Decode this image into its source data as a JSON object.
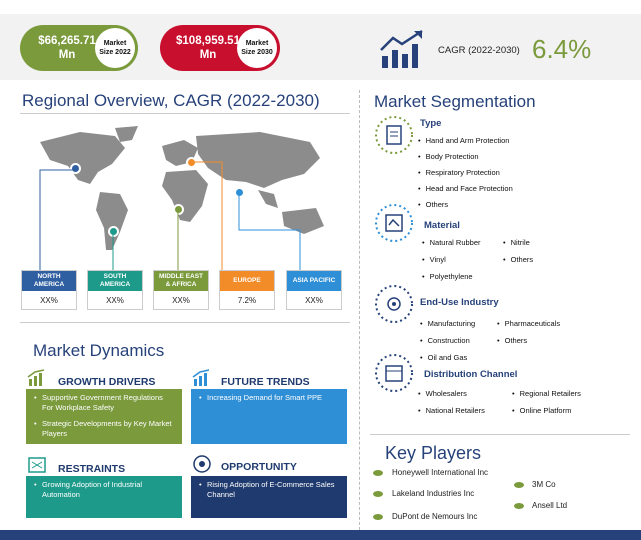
{
  "header": {
    "size_2022": {
      "value": "$66,265.71",
      "unit": "Mn",
      "label1": "Market",
      "label2": "Size 2022"
    },
    "size_2030": {
      "value": "$108,959.51",
      "unit": "Mn",
      "label1": "Market",
      "label2": "Size 2030"
    },
    "cagr_label": "CAGR (2022-2030)",
    "cagr_value": "6.4%"
  },
  "regional": {
    "title": "Regional Overview,  CAGR (2022-2030)",
    "regions": [
      {
        "name1": "NORTH",
        "name2": "AMERICA",
        "value": "XX%",
        "color": "#2f5fa0"
      },
      {
        "name1": "SOUTH",
        "name2": "AMERICA",
        "value": "XX%",
        "color": "#1d9a8a"
      },
      {
        "name1": "MIDDLE EAST",
        "name2": "& AFRICA",
        "value": "XX%",
        "color": "#7a9a3c"
      },
      {
        "name1": "EUROPE",
        "name2": "",
        "value": "7.2%",
        "color": "#f28c28"
      },
      {
        "name1": "ASIA PACIFIC",
        "name2": "",
        "value": "XX%",
        "color": "#2f8fd6"
      }
    ]
  },
  "segmentation": {
    "title": "Market Segmentation",
    "type": {
      "title": "Type",
      "items": [
        "Hand and Arm Protection",
        "Body Protection",
        "Respiratory Protection",
        "Head and Face Protection",
        "Others"
      ]
    },
    "material": {
      "title": "Material",
      "items": [
        "Natural Rubber",
        "Nitrile",
        "Vinyl",
        "Others",
        "Polyethylene"
      ]
    },
    "end_use": {
      "title": "End-Use Industry",
      "items": [
        "Manufacturing",
        "Pharmaceuticals",
        "Construction",
        "Others",
        "Oil and Gas"
      ]
    },
    "distribution": {
      "title": "Distribution Channel",
      "items": [
        "Wholesalers",
        "Regional Retailers",
        "National Retailers",
        "Online Platform"
      ]
    }
  },
  "dynamics": {
    "title": "Market Dynamics",
    "growth_drivers": {
      "title": "GROWTH DRIVERS",
      "items": [
        "Supportive Government Regulations For Workplace Safety",
        "Strategic Developments by Key Market Players"
      ],
      "color": "#7a9a3c"
    },
    "future_trends": {
      "title": "FUTURE TRENDS",
      "items": [
        "Increasing Demand for Smart PPE"
      ],
      "color": "#2f8fd6"
    },
    "restraints": {
      "title": "RESTRAINTS",
      "items": [
        "Growing Adoption of Industrial Automation"
      ],
      "color": "#1d9a8a"
    },
    "opportunity": {
      "title": "OPPORTUNITY",
      "items": [
        "Rising Adoption of E-Commerce Sales Channel"
      ],
      "color": "#1f3a6e"
    }
  },
  "key_players": {
    "title": "Key Players",
    "items": [
      "Honeywell International Inc",
      "3M Co",
      "Lakeland Industries Inc",
      "Ansell Ltd",
      "DuPont de Nemours Inc"
    ]
  }
}
